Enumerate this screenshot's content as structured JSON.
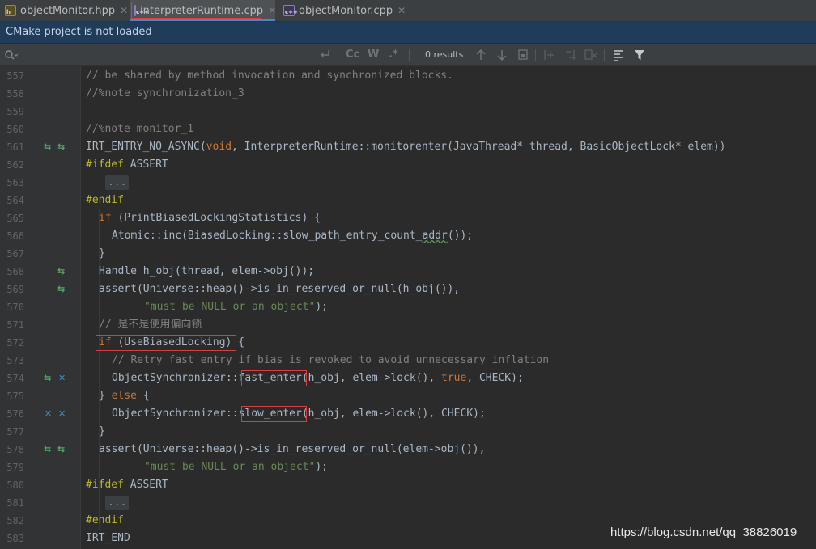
{
  "tabs": [
    {
      "name": "objectMonitor.hpp",
      "type": "hpp",
      "active": false
    },
    {
      "name": "interpreterRuntime.cpp",
      "type": "cpp",
      "active": true
    },
    {
      "name": "objectMonitor.cpp",
      "type": "cpp",
      "active": false
    }
  ],
  "file_icon_glyph": "c++",
  "file_icon_glyph_h": "h",
  "close_glyph": "✕",
  "notification": "CMake project is not loaded",
  "search": {
    "placeholder": "",
    "match_case": "Cc",
    "words": "W",
    "regex": ".*",
    "results": "0 results"
  },
  "gutter_icons": {
    "561": [
      "override-switch-icon",
      "override-switch-icon"
    ],
    "568": [
      "override-switch-icon"
    ],
    "569": [
      "override-switch-icon"
    ],
    "574": [
      "override-switch-icon",
      "crossed-icon"
    ],
    "576": [
      "crossed-icon",
      "crossed-icon"
    ],
    "578": [
      "override-switch-icon",
      "override-switch-icon"
    ]
  },
  "code": {
    "l557": {
      "num": "557",
      "t1": "// be shared by method invocation and synchronized blocks."
    },
    "l558": {
      "num": "558",
      "t1": "//%note synchronization_3"
    },
    "l559": {
      "num": "559"
    },
    "l560": {
      "num": "560",
      "t1": "//%note monitor_1"
    },
    "l561": {
      "num": "561",
      "t1": "IRT_ENTRY_NO_ASYNC(",
      "t2": "void",
      "t3": ", InterpreterRuntime::monitorenter(JavaThread* thread, BasicObjectLock* elem))"
    },
    "l562": {
      "num": "562",
      "t1": "#ifdef",
      "t2": " ASSERT"
    },
    "l563": {
      "num": "563",
      "t1": "..."
    },
    "l564": {
      "num": "564",
      "t1": "#endif"
    },
    "l565": {
      "num": "565",
      "t1": "if",
      "t2": " (PrintBiasedLockingStatistics) {"
    },
    "l566": {
      "num": "566",
      "t1": "Atomic::inc(BiasedLocking::slow_path_entry_count_",
      "t2": "addr",
      "t3": "());"
    },
    "l567": {
      "num": "567",
      "t1": "}"
    },
    "l568": {
      "num": "568",
      "t1": "Handle h_obj(thread, elem->obj());"
    },
    "l569": {
      "num": "569",
      "t1": "assert(Universe::heap()->is_in_reserved_or_null(h_obj()),"
    },
    "l570": {
      "num": "570",
      "t1": "\"must be NULL or an object\"",
      "t2": ");"
    },
    "l571": {
      "num": "571",
      "t1": "// 是不是使用偏向锁"
    },
    "l572": {
      "num": "572",
      "t1": "if",
      "t2": " (UseBiasedLocking)",
      "t3": " {"
    },
    "l573": {
      "num": "573",
      "t1": "// Retry fast entry if bias is revoked to avoid unnecessary inflation"
    },
    "l574": {
      "num": "574",
      "t1": "ObjectSynchronizer::",
      "t2": "fast_enter",
      "t3": "(h_obj, elem->lock(), ",
      "t4": "true",
      "t5": ", CHECK);"
    },
    "l575": {
      "num": "575",
      "t1": "} ",
      "t2": "else",
      "t3": " {"
    },
    "l576": {
      "num": "576",
      "t1": "ObjectSynchronizer::",
      "t2": "slow_enter",
      "t3": "(h_obj, elem->lock(), CHECK);"
    },
    "l577": {
      "num": "577",
      "t1": "}"
    },
    "l578": {
      "num": "578",
      "t1": "assert(Universe::heap()->is_in_reserved_or_null(elem->obj()),"
    },
    "l579": {
      "num": "579",
      "t1": "\"must be NULL or an object\"",
      "t2": ");"
    },
    "l580": {
      "num": "580",
      "t1": "#ifdef",
      "t2": " ASSERT"
    },
    "l581": {
      "num": "581",
      "t1": "..."
    },
    "l582": {
      "num": "582",
      "t1": "#endif"
    },
    "l583": {
      "num": "583",
      "t1": "IRT_END"
    }
  },
  "watermark": "https://blog.csdn.net/qq_38826019",
  "colors": {
    "editor_bg": "#2b2b2b",
    "gutter_bg": "#313335",
    "comment": "#808080",
    "doc_comment": "#629755",
    "keyword": "#cc7832",
    "string": "#6a8759",
    "preprocessor": "#bbb529",
    "text": "#a9b7c6",
    "highlight_box": "#e03a3a",
    "notification_bg": "#1f3d5b"
  }
}
